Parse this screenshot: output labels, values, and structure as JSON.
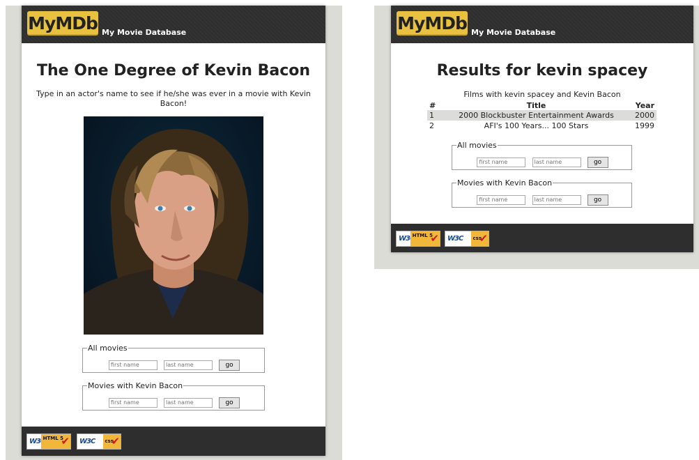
{
  "site": {
    "logo_text": "MyMDb",
    "title": "My Movie Database"
  },
  "colors": {
    "header_bg": "#2e2e2e",
    "logo_bg": "#e9c140",
    "page_bg": "#dcdcd6"
  },
  "left_page": {
    "heading": "The One Degree of Kevin Bacon",
    "intro": "Type in an actor's name to see if he/she was ever in a movie with Kevin Bacon!",
    "photo_alt": "Kevin Bacon"
  },
  "right_page": {
    "heading": "Results for kevin spacey",
    "caption": "Films with kevin spacey and Kevin Bacon",
    "table": {
      "columns": [
        "#",
        "Title",
        "Year"
      ],
      "rows": [
        {
          "num": "1",
          "title": "2000 Blockbuster Entertainment Awards",
          "year": "2000"
        },
        {
          "num": "2",
          "title": "AFI's 100 Years... 100 Stars",
          "year": "1999"
        }
      ]
    }
  },
  "forms": {
    "all_movies_legend": "All movies",
    "with_bacon_legend": "Movies with Kevin Bacon",
    "first_placeholder": "first name",
    "last_placeholder": "last name",
    "go_label": "go"
  },
  "footer": {
    "w3c": "W3C",
    "html_badge": "HTML 5",
    "css_badge": "css"
  }
}
